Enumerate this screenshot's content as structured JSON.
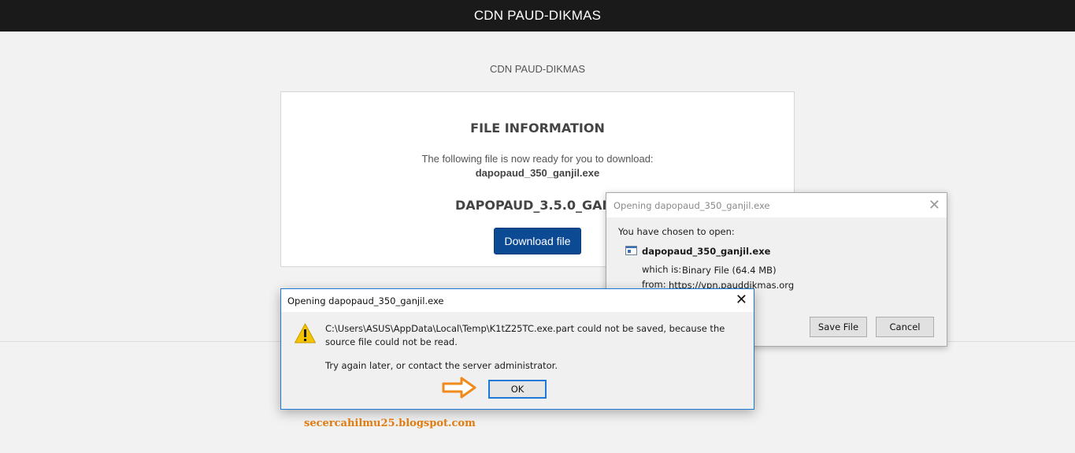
{
  "topbar": {
    "title": "CDN PAUD-DIKMAS"
  },
  "site": {
    "subtitle": "CDN PAUD-DIKMAS"
  },
  "card": {
    "heading": "FILE INFORMATION",
    "description": "The following file is now ready for you to download:",
    "filename": "dapopaud_350_ganjil.exe",
    "product_visible": "DAPOPAUD_3.5.0_GANJ",
    "download_label": "Download file"
  },
  "open_dialog": {
    "title": "Opening dapopaud_350_ganjil.exe",
    "close_glyph": "✕",
    "prompt": "You have chosen to open:",
    "filename": "dapopaud_350_ganjil.exe",
    "which_label": "which is:",
    "which_value": "Binary File (64.4 MB)",
    "from_label": "from:",
    "from_value": "https://vpn.pauddikmas.org",
    "save_label": "Save File",
    "cancel_label": "Cancel"
  },
  "error_dialog": {
    "title": "Opening dapopaud_350_ganjil.exe",
    "close_glyph": "✕",
    "message": "C:\\Users\\ASUS\\AppData\\Local\\Temp\\K1tZ25TC.exe.part could not be saved, because the source file could not be read.",
    "hint": "Try again later, or contact the server administrator.",
    "ok_label": "OK"
  },
  "watermark": {
    "text": "secercahilmu25.blogspot.com"
  },
  "colors": {
    "topbar_bg": "#1a1a1a",
    "download_button": "#0d4a94",
    "dialog_focus_border": "#1e78d6",
    "warning_icon": "#f5c400",
    "annotation_orange": "#e07b10"
  },
  "icons": {
    "file_icon": "binary-file-icon",
    "warning_icon": "warning-triangle-icon",
    "arrow": "arrow-right-annotation-icon"
  }
}
